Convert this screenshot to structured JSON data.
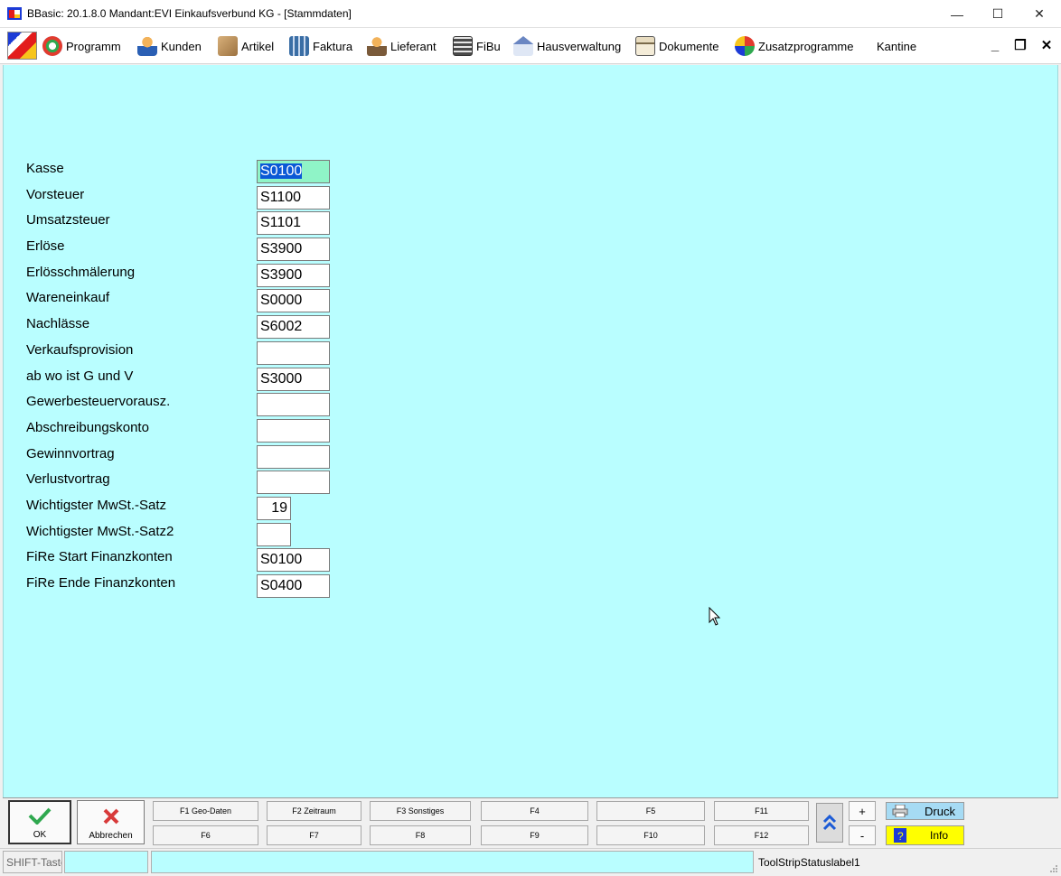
{
  "window": {
    "title": "BBasic: 20.1.8.0 Mandant:EVI Einkaufsverbund KG  - [Stammdaten]",
    "minimize_glyph": "—",
    "maximize_glyph": "☐",
    "close_glyph": "✕"
  },
  "menu": {
    "items": [
      {
        "label": "Programm",
        "icon": "programm-icon",
        "color": "#e23b2e"
      },
      {
        "label": "Kunden",
        "icon": "kunden-icon",
        "color": "#e59a2a"
      },
      {
        "label": "Artikel",
        "icon": "artikel-icon",
        "color": "#b48a52"
      },
      {
        "label": "Faktura",
        "icon": "faktura-icon",
        "color": "#3a6ea5"
      },
      {
        "label": "Lieferant",
        "icon": "lieferant-icon",
        "color": "#c0703a"
      },
      {
        "label": "FiBu",
        "icon": "fibu-icon",
        "color": "#4a4a4a"
      },
      {
        "label": "Hausverwaltung",
        "icon": "hausverwaltung-icon",
        "color": "#6a86c2"
      },
      {
        "label": "Dokumente",
        "icon": "dokumente-icon",
        "color": "#7a6a4a"
      },
      {
        "label": "Zusatzprogramme",
        "icon": "zusatzprogramme-icon",
        "color": "#2fa84f"
      },
      {
        "label": "Kantine",
        "icon": "",
        "color": ""
      }
    ],
    "mdi_minimize": "_",
    "mdi_restore": "❐",
    "mdi_close": "✕"
  },
  "form": {
    "fields": [
      {
        "label": "Kasse",
        "value": "S0100"
      },
      {
        "label": "Vorsteuer",
        "value": "S1100"
      },
      {
        "label": "Umsatzsteuer",
        "value": "S1101"
      },
      {
        "label": "Erlöse",
        "value": "S3900"
      },
      {
        "label": "Erlösschmälerung",
        "value": "S3900"
      },
      {
        "label": "Wareneinkauf",
        "value": "S0000"
      },
      {
        "label": "Nachlässe",
        "value": "S6002"
      },
      {
        "label": "Verkaufsprovision",
        "value": ""
      },
      {
        "label": "ab wo ist G und V",
        "value": "S3000"
      },
      {
        "label": "Gewerbesteuervorausz.",
        "value": ""
      },
      {
        "label": "Abschreibungskonto",
        "value": ""
      },
      {
        "label": "Gewinnvortrag",
        "value": ""
      },
      {
        "label": "Verlustvortrag",
        "value": ""
      },
      {
        "label": "Wichtigster MwSt.-Satz",
        "value": "19"
      },
      {
        "label": "Wichtigster MwSt.-Satz2",
        "value": ""
      },
      {
        "label": "FiRe Start Finanzkonten",
        "value": "S0100"
      },
      {
        "label": "FiRe Ende Finanzkonten",
        "value": "S0400"
      }
    ],
    "background": "#b9feff",
    "focus_color": "#8ff4c7"
  },
  "toolbar": {
    "ok_label": "OK",
    "cancel_label": "Abbrechen",
    "fkeys_row1": [
      "F1 Geo-Daten",
      "F2 Zeitraum",
      "F3 Sonstiges",
      "F4",
      "F5",
      "F11"
    ],
    "fkeys_row2": [
      "F6",
      "F7",
      "F8",
      "F9",
      "F10",
      "F12"
    ],
    "plus_label": "+",
    "minus_label": "-",
    "druck_label": "Druck",
    "info_label": "Info"
  },
  "status": {
    "shift_label": "SHIFT-Taste",
    "label1": "ToolStripStatuslabel1"
  }
}
